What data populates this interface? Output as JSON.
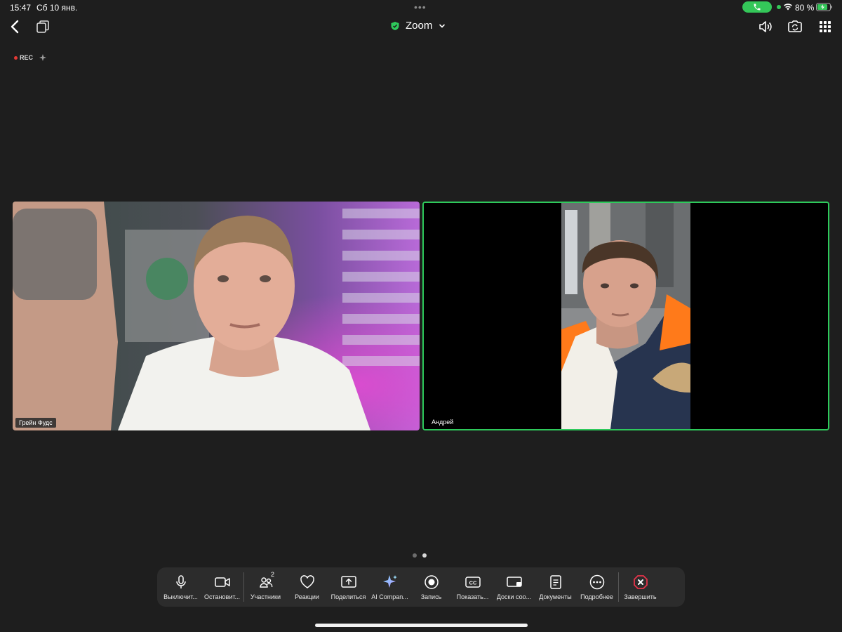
{
  "status_bar": {
    "time": "15:47",
    "date": "Сб 10 янв.",
    "battery_percent": "80 %"
  },
  "header": {
    "title": "Zoom"
  },
  "recording": {
    "label": "REC"
  },
  "participants": [
    {
      "name": "Грейн Фудс",
      "active_speaker": false
    },
    {
      "name": "Андрей",
      "active_speaker": true
    }
  ],
  "toolbar": {
    "mute_label": "Выключит...",
    "video_label": "Остановит...",
    "participants_label": "Участники",
    "participants_count": "2",
    "reactions_label": "Реакции",
    "share_label": "Поделиться",
    "ai_label": "AI Compan...",
    "record_label": "Запись",
    "cc_label": "Показать...",
    "whiteboards_label": "Доски соо...",
    "docs_label": "Документы",
    "more_label": "Подробнее",
    "end_label": "Завершить"
  },
  "colors": {
    "background": "#1e1e1e",
    "active_speaker_border": "#2ec95b",
    "end_red": "#e5334a",
    "call_green": "#34c759"
  }
}
